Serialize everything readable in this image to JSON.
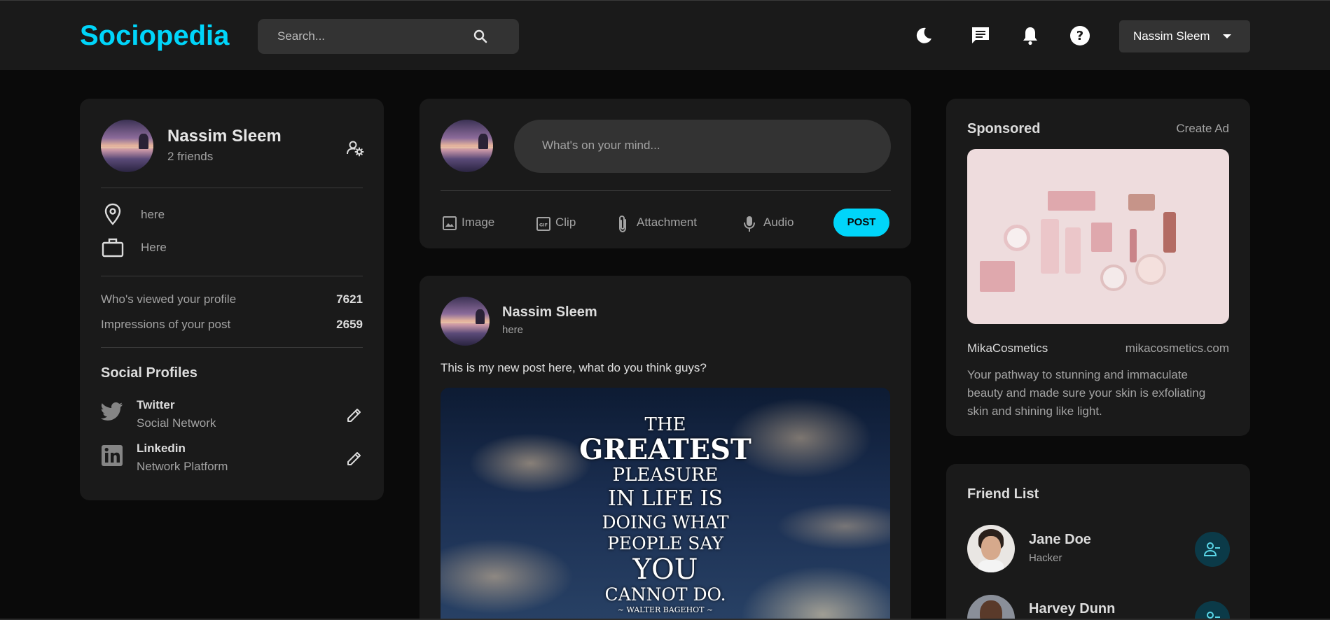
{
  "brand": {
    "name": "Sociopedia",
    "accent": "#00d5fa"
  },
  "search": {
    "placeholder": "Search..."
  },
  "nav": {
    "icons": [
      "dark-mode-icon",
      "message-icon",
      "notification-icon",
      "help-icon"
    ],
    "user_name": "Nassim Sleem"
  },
  "user_widget": {
    "name": "Nassim Sleem",
    "friends": "2 friends",
    "location": "here",
    "occupation": "Here",
    "viewed_label": "Who's viewed your profile",
    "viewed_value": "7621",
    "impressions_label": "Impressions of your post",
    "impressions_value": "2659",
    "social_title": "Social Profiles",
    "socials": [
      {
        "name": "Twitter",
        "type": "Social Network"
      },
      {
        "name": "Linkedin",
        "type": "Network Platform"
      }
    ]
  },
  "composer": {
    "placeholder": "What's on your mind...",
    "actions": [
      "Image",
      "Clip",
      "Attachment",
      "Audio"
    ],
    "post_label": "POST"
  },
  "post": {
    "author": "Nassim Sleem",
    "location": "here",
    "text": "This is my new post here, what do you think guys?",
    "image_quote": {
      "lines": [
        "THE",
        "GREATEST",
        "PLEASURE",
        "IN LIFE IS",
        "DOING WHAT",
        "PEOPLE SAY",
        "YOU",
        "CANNOT DO."
      ],
      "attribution": "~ WALTER BAGEHOT ~"
    }
  },
  "ad": {
    "title": "Sponsored",
    "create_label": "Create Ad",
    "brand": "MikaCosmetics",
    "url": "mikacosmetics.com",
    "description_lines": [
      "Your pathway to stunning and immaculate",
      "beauty and made sure your skin is exfoliating",
      "skin and shining like light."
    ]
  },
  "friends": {
    "title": "Friend List",
    "items": [
      {
        "name": "Jane Doe",
        "role": "Hacker"
      },
      {
        "name": "Harvey Dunn",
        "role": ""
      }
    ]
  }
}
